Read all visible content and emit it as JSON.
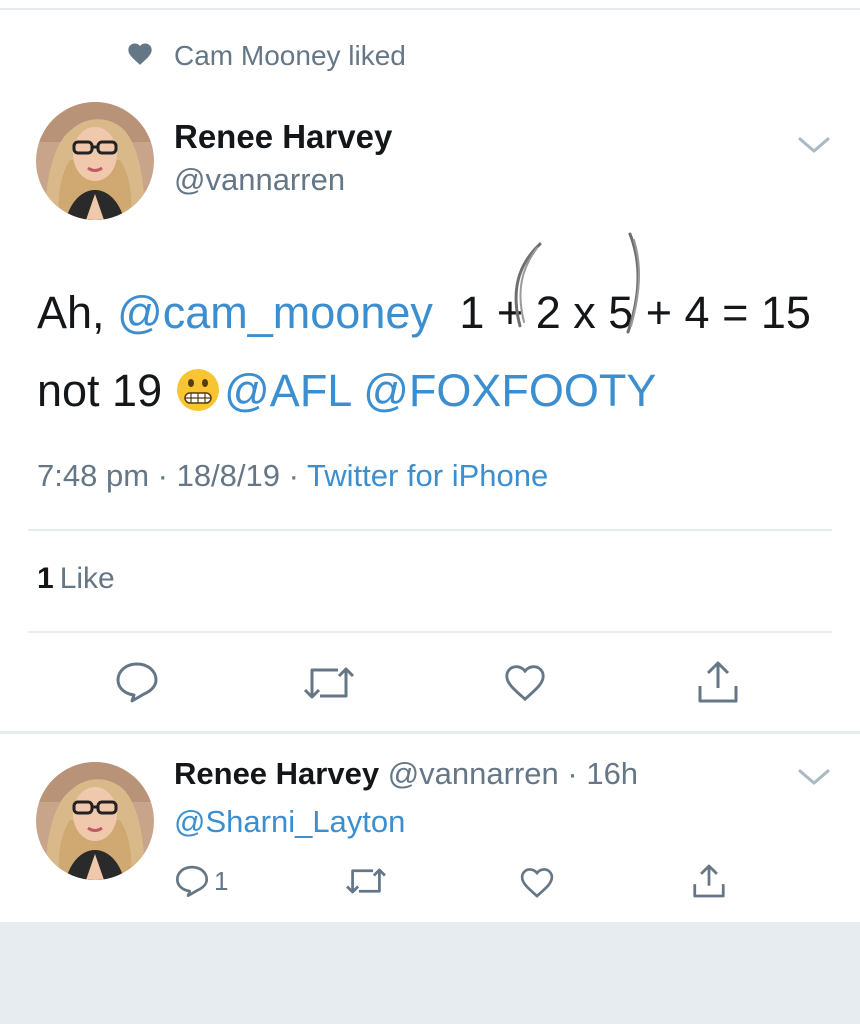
{
  "colors": {
    "link": "#3b8fd0",
    "secondary": "#657786",
    "divider": "#e6ecf0",
    "footer": "#e6ecf0"
  },
  "social_context": {
    "icon": "heart-icon",
    "text": "Cam Mooney liked"
  },
  "tweet": {
    "author_name": "Renee Harvey",
    "author_handle": "@vannarren",
    "text_prefix": "Ah,",
    "mention_1": "@cam_mooney",
    "equation": "1 + 2 x 5 + 4 = 15",
    "text_not": "not 19",
    "emoji": "grimacing-face",
    "mention_2": "@AFL",
    "mention_3": "@FOXFOOTY",
    "handwritten_annotation": "( )",
    "time": "7:48 pm",
    "date": "18/8/19",
    "source": "Twitter for iPhone",
    "likes_count": "1",
    "likes_label": "Like"
  },
  "actions": [
    "reply-icon",
    "retweet-icon",
    "like-icon",
    "share-icon"
  ],
  "reply": {
    "author_name": "Renee Harvey",
    "author_handle": "@vannarren",
    "time_ago": "16h",
    "mention": "@Sharni_Layton",
    "reply_count": "1"
  }
}
